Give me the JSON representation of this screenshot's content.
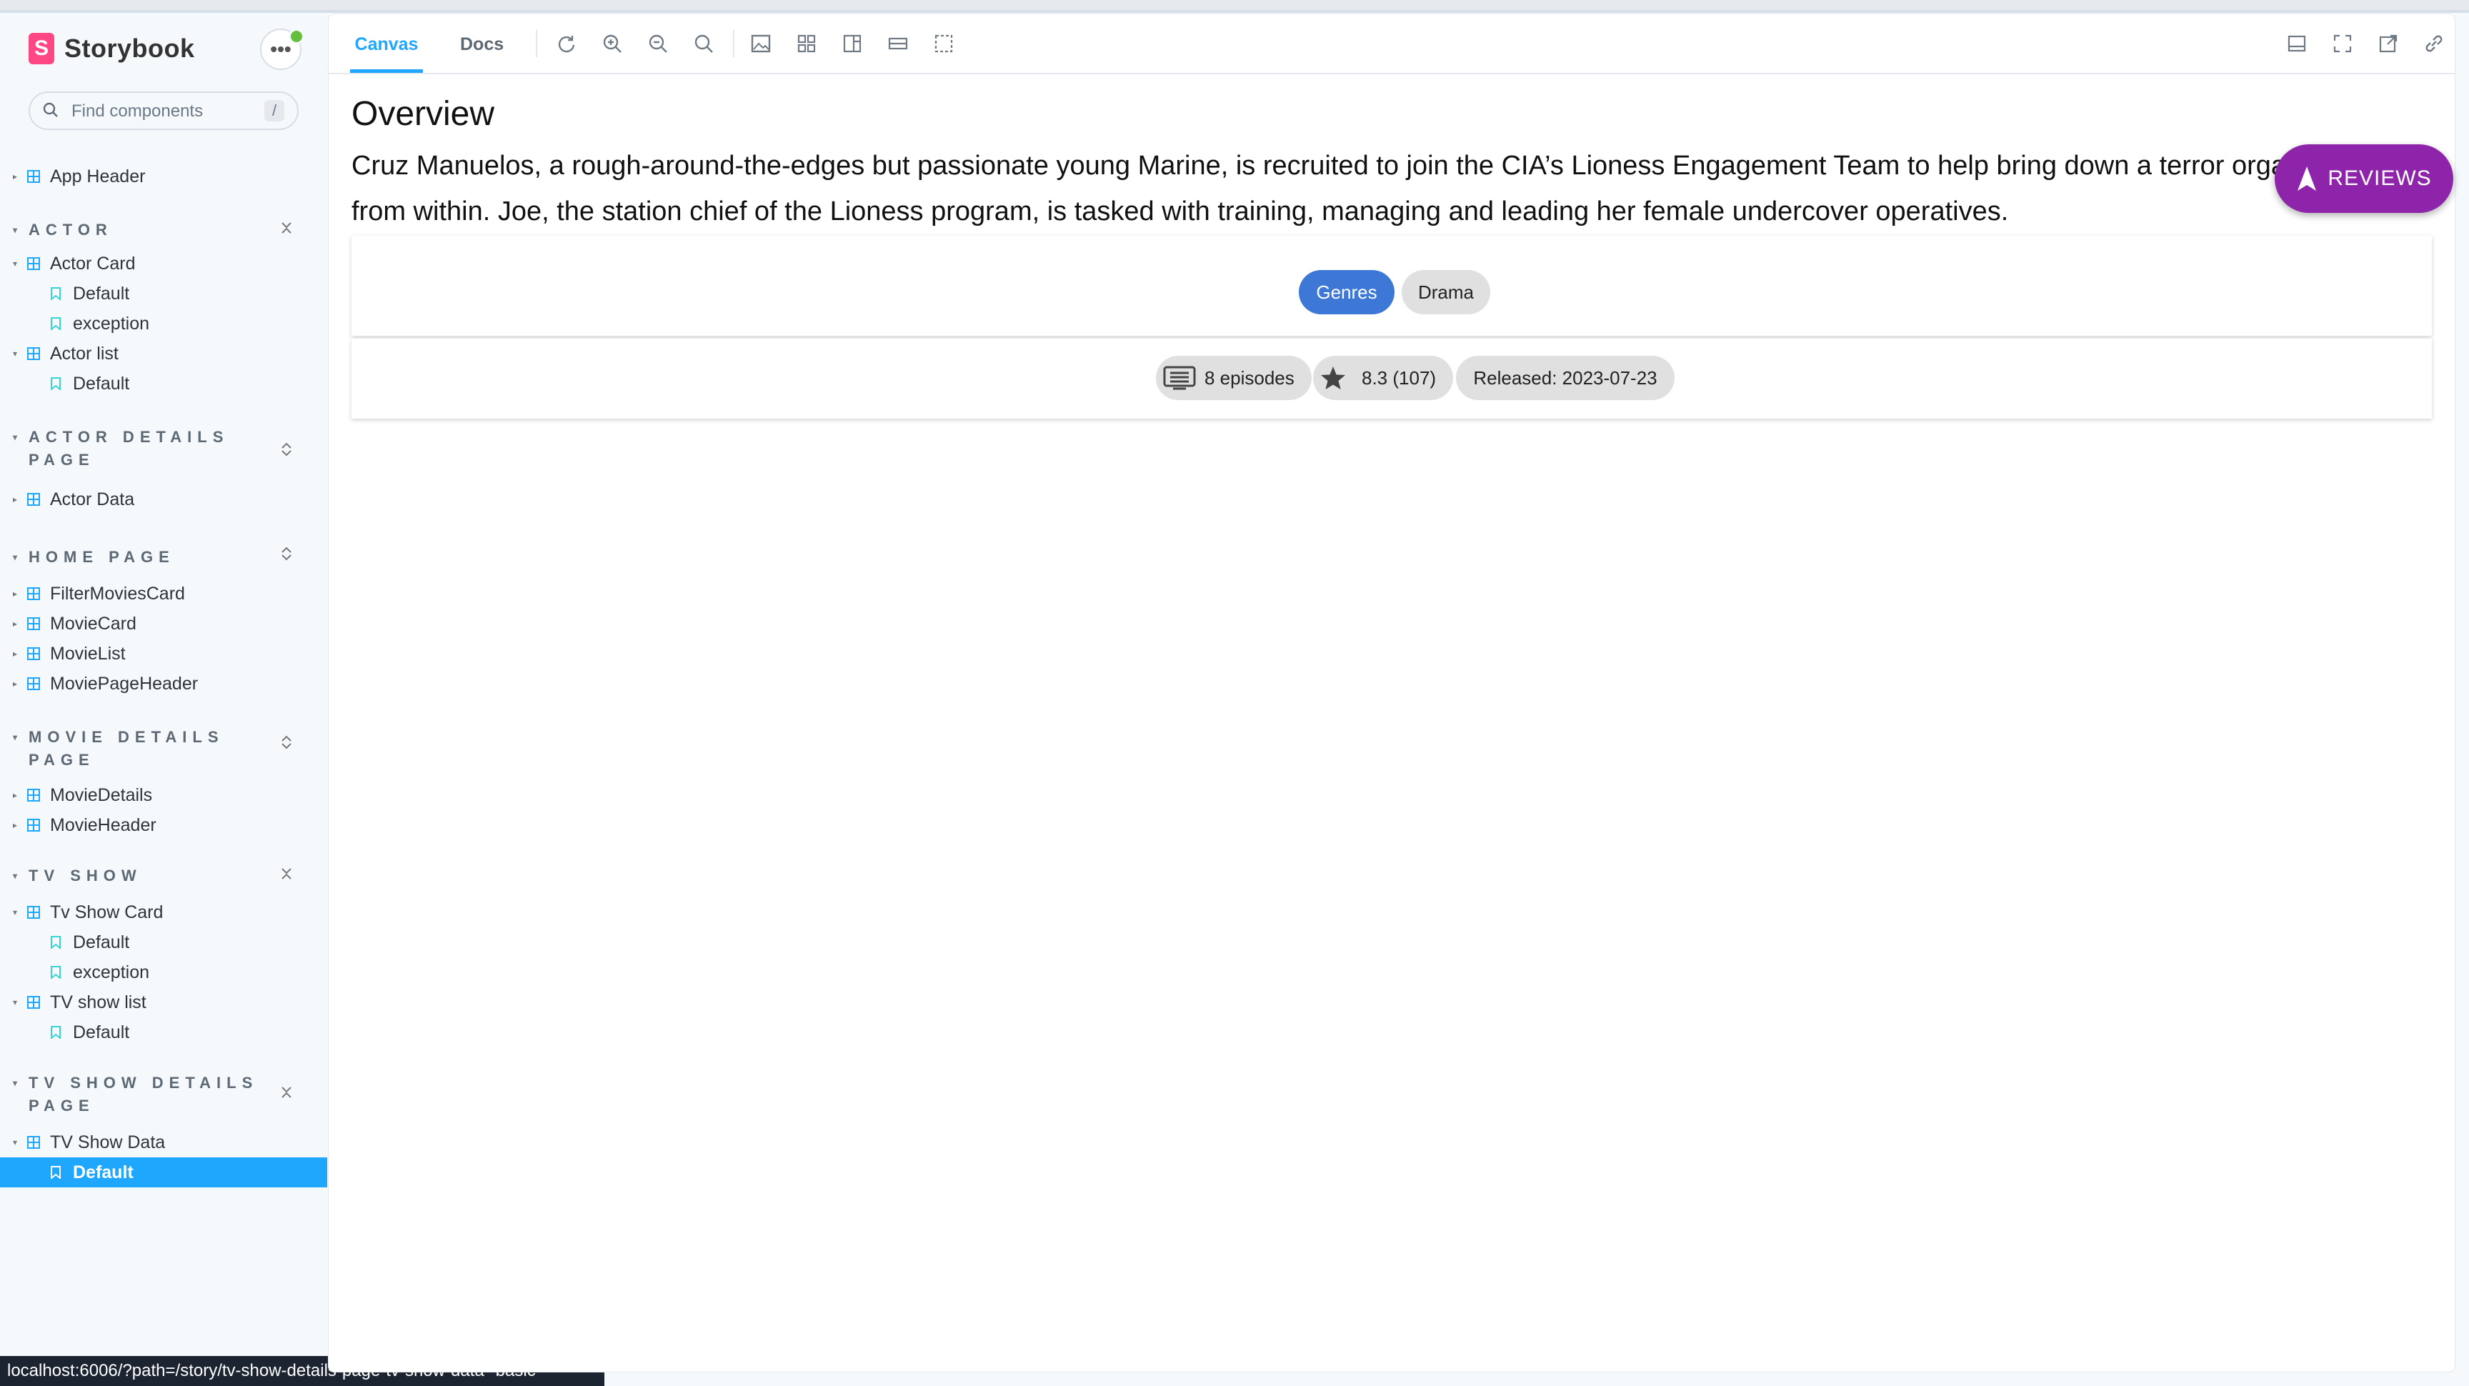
{
  "app": {
    "name": "Storybook",
    "logo_letter": "S"
  },
  "sidebar": {
    "menu_label": "•••",
    "search": {
      "placeholder": "Find components",
      "shortcut": "/"
    },
    "app_header": "App Header",
    "sections": {
      "actor": "ACTOR",
      "actor_details": "ACTOR DETAILS PAGE",
      "home_page": "HOME PAGE",
      "movie_details": "MOVIE DETAILS PAGE",
      "tv_show": "TV SHOW",
      "tv_show_details": "TV SHOW DETAILS PAGE"
    },
    "items": {
      "actor_card": "Actor Card",
      "actor_card_default": "Default",
      "actor_card_exception": "exception",
      "actor_list": "Actor list",
      "actor_list_default": "Default",
      "actor_data": "Actor Data",
      "filter_movies_card": "FilterMoviesCard",
      "movie_card": "MovieCard",
      "movie_list": "MovieList",
      "movie_page_header": "MoviePageHeader",
      "movie_details": "MovieDetails",
      "movie_header": "MovieHeader",
      "tv_show_card": "Tv Show Card",
      "tv_show_card_default": "Default",
      "tv_show_card_exception": "exception",
      "tv_show_list": "TV show list",
      "tv_show_list_default": "Default",
      "tv_show_data": "TV Show Data",
      "tv_show_data_default": "Default"
    }
  },
  "status_url": "localhost:6006/?path=/story/tv-show-details-page-tv-show-data--basic",
  "toolbar": {
    "tab_canvas": "Canvas",
    "tab_docs": "Docs"
  },
  "canvas": {
    "overview_title": "Overview",
    "overview_text": "Cruz Manuelos, a rough-around-the-edges but passionate young Marine, is recruited to join the CIA’s Lioness Engagement Team to help bring down a terror organization from within. Joe, the station chief of the Lioness program, is tasked with training, managing and leading her female undercover operatives.",
    "genres_label": "Genres",
    "genre": "Drama",
    "episodes": "8 episodes",
    "rating": "8.3 (107)",
    "released": "Released: 2023-07-23",
    "reviews_button": "REVIEWS"
  },
  "colors": {
    "accent": "#1ea7fd",
    "fab": "#8e24aa",
    "chip_primary": "#3d78d6",
    "brand": "#ff4785"
  }
}
